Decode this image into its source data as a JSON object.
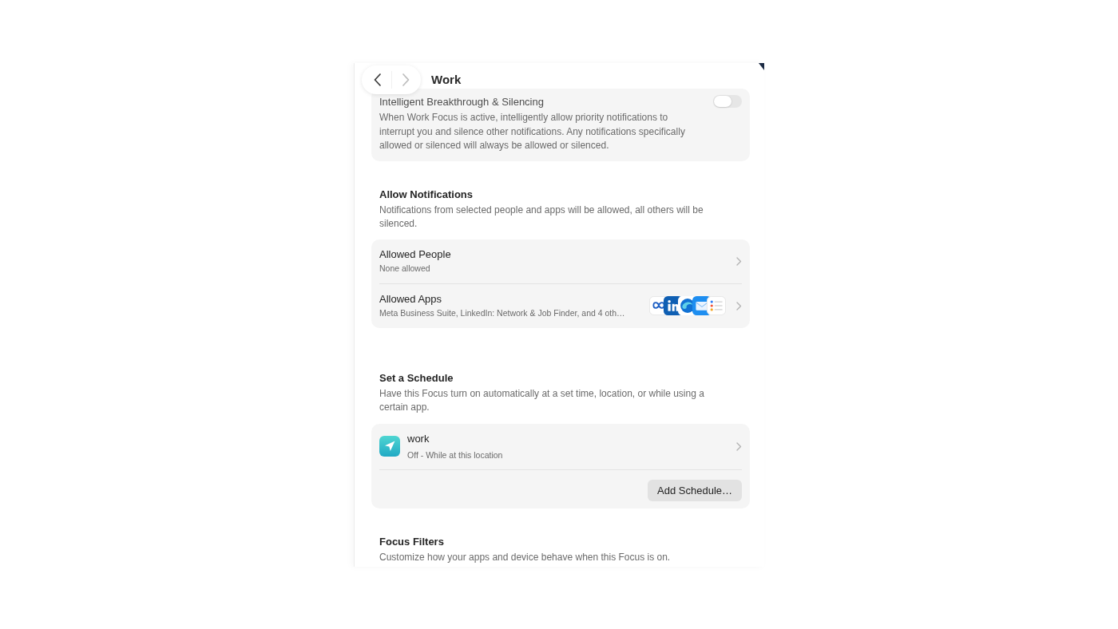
{
  "header": {
    "title": "Work"
  },
  "nav": [
    {
      "kind": "back",
      "disabled": false
    },
    {
      "kind": "forward",
      "disabled": true
    }
  ],
  "breakthrough": {
    "title": "Intelligent Breakthrough & Silencing",
    "description": "When Work Focus is active, intelligently allow priority notifications to interrupt you and silence other notifications. Any notifications specifically allowed or silenced will always be allowed or silenced.",
    "on": false
  },
  "sections": [
    {
      "heading": "Allow Notifications",
      "description": "Notifications from selected people and apps will be allowed, all others will be silenced.",
      "rows": [
        {
          "kind": "plain",
          "title": "Allowed People",
          "subtitle": "None allowed"
        },
        {
          "kind": "apps",
          "title": "Allowed Apps",
          "subtitle": "Meta Business Suite, LinkedIn: Network & Job Finder, and 4 oth…"
        }
      ]
    },
    {
      "heading": "Set a Schedule",
      "description": "Have this Focus turn on automatically at a set time, location, or while using a certain app.",
      "rows": [
        {
          "kind": "location",
          "title": "work",
          "subtitle": "Off - While at this location"
        }
      ],
      "button": "Add Schedule…"
    },
    {
      "heading": "Focus Filters",
      "description": "Customize how your apps and device behave when this Focus is on."
    }
  ]
}
